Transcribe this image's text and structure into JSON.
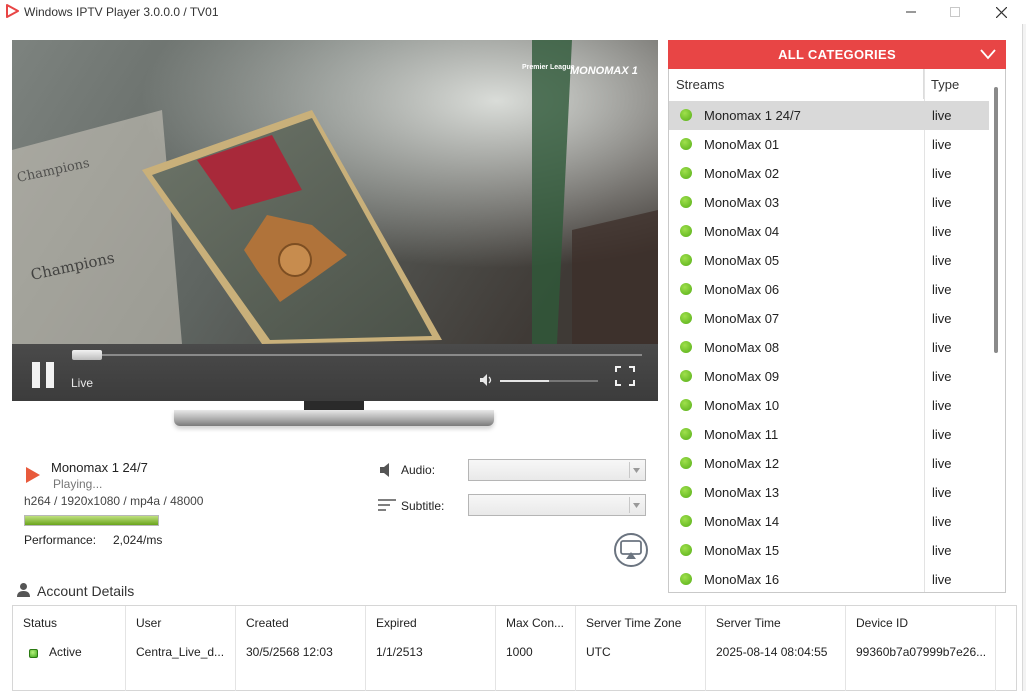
{
  "window": {
    "title": "Windows IPTV Player 3.0.0.0 / TV01",
    "logo_icon": "play-triangle-icon",
    "accent": "#e84545"
  },
  "player": {
    "live_label": "Live",
    "seek_progress": 0.03,
    "volume_level": 0.5,
    "video_overlay": [
      "Premier League",
      "MONOMAX 1"
    ]
  },
  "now_playing": {
    "title": "Monomax 1 24/7",
    "status": "Playing...",
    "codec": "h264 / 1920x1080 / mp4a / 48000",
    "performance_label": "Performance:",
    "performance_value": "2,024/ms",
    "performance_level": 1.0,
    "audio_label": "Audio:",
    "subtitle_label": "Subtitle:"
  },
  "categories": {
    "header": "ALL CATEGORIES",
    "col_streams": "Streams",
    "col_type": "Type",
    "status_color": "#55ad17",
    "items": [
      {
        "name": "Monomax 1 24/7",
        "type": "live",
        "selected": true
      },
      {
        "name": "MonoMax 01",
        "type": "live"
      },
      {
        "name": "MonoMax 02",
        "type": "live"
      },
      {
        "name": "MonoMax 03",
        "type": "live"
      },
      {
        "name": "MonoMax 04",
        "type": "live"
      },
      {
        "name": "MonoMax 05",
        "type": "live"
      },
      {
        "name": "MonoMax 06",
        "type": "live"
      },
      {
        "name": "MonoMax 07",
        "type": "live"
      },
      {
        "name": "MonoMax 08",
        "type": "live"
      },
      {
        "name": "MonoMax 09",
        "type": "live"
      },
      {
        "name": "MonoMax 10",
        "type": "live"
      },
      {
        "name": "MonoMax 11",
        "type": "live"
      },
      {
        "name": "MonoMax 12",
        "type": "live"
      },
      {
        "name": "MonoMax 13",
        "type": "live"
      },
      {
        "name": "MonoMax 14",
        "type": "live"
      },
      {
        "name": "MonoMax 15",
        "type": "live"
      },
      {
        "name": "MonoMax 16",
        "type": "live"
      }
    ]
  },
  "account": {
    "title": "Account Details",
    "headers": [
      "Status",
      "User",
      "Created",
      "Expired",
      "Max Con...",
      "Server Time Zone",
      "Server Time",
      "Device ID"
    ],
    "values": [
      "Active",
      "Centra_Live_d...",
      "30/5/2568 12:03",
      "1/1/2513",
      "1000",
      "UTC",
      "2025-08-14 08:04:55",
      "99360b7a07999b7e26..."
    ]
  }
}
